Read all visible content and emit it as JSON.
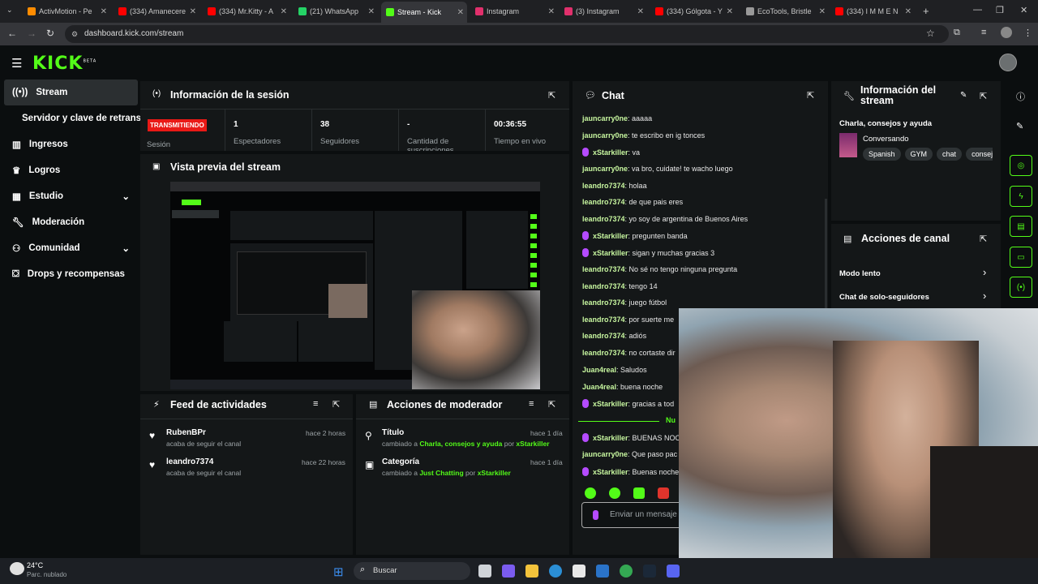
{
  "browser": {
    "tabs": [
      {
        "label": "ActivMotion - Pe",
        "color": "#ff8c00"
      },
      {
        "label": "(334) Amanecere",
        "color": "#ff0000"
      },
      {
        "label": "(334) Mr.Kitty - A",
        "color": "#ff0000"
      },
      {
        "label": "(21) WhatsApp",
        "color": "#25d366"
      },
      {
        "label": "Stream - Kick",
        "color": "#53fc18"
      },
      {
        "label": "Instagram",
        "color": "#e1306c"
      },
      {
        "label": "(3) Instagram",
        "color": "#e1306c"
      },
      {
        "label": "(334) Gólgota - Y",
        "color": "#ff0000"
      },
      {
        "label": "EcoTools, Bristle",
        "color": "#999999"
      },
      {
        "label": "(334) I M M E N",
        "color": "#ff0000"
      }
    ],
    "url": "dashboard.kick.com/stream"
  },
  "brand": {
    "logo": "KICK",
    "beta": "BETA",
    "accent": "#53fc18"
  },
  "sidebar": {
    "items": [
      {
        "label": "Stream",
        "icon": "broadcast-icon"
      },
      {
        "label": "Servidor y clave de retransm",
        "icon": ""
      },
      {
        "label": "Ingresos",
        "icon": "chart-icon"
      },
      {
        "label": "Logros",
        "icon": "trophy-icon"
      },
      {
        "label": "Estudio",
        "icon": "studio-icon"
      },
      {
        "label": "Moderación",
        "icon": "wrench-icon"
      },
      {
        "label": "Comunidad",
        "icon": "community-icon"
      },
      {
        "label": "Drops y recompensas",
        "icon": "gift-icon"
      }
    ]
  },
  "session": {
    "title": "Información de la sesión",
    "status": "TRANSMITIENDO",
    "session_label": "Sesión",
    "stats": [
      {
        "value": "1",
        "label": "Espectadores"
      },
      {
        "value": "38",
        "label": "Seguidores"
      },
      {
        "value": "-",
        "label": "Cantidad de suscripciones"
      },
      {
        "value": "00:36:55",
        "label": "Tiempo en vivo"
      }
    ]
  },
  "preview": {
    "title": "Vista previa del stream"
  },
  "activity": {
    "title": "Feed de actividades",
    "items": [
      {
        "user": "RubenBPr",
        "text": "acaba de seguir el canal",
        "time": "hace 2 horas"
      },
      {
        "user": "leandro7374",
        "text": "acaba de seguir el canal",
        "time": "hace 22 horas"
      }
    ]
  },
  "modactions": {
    "title": "Acciones de moderador",
    "items": [
      {
        "title": "Título",
        "prefix": "cambiado a",
        "value": "Charla, consejos y ayuda",
        "by": "por",
        "user": "xStarkiller",
        "time": "hace 1 día"
      },
      {
        "title": "Categoría",
        "prefix": "cambiado a",
        "value": "Just Chatting",
        "by": "por",
        "user": "xStarkiller",
        "time": "hace 1 día"
      }
    ]
  },
  "chat": {
    "title": "Chat",
    "messages": [
      {
        "user": "jauncarry0ne",
        "text": "aaaaa",
        "mod": false
      },
      {
        "user": "jauncarry0ne",
        "text": "te escribo en ig tonces",
        "mod": false
      },
      {
        "user": "xStarkiller",
        "text": "va",
        "mod": true
      },
      {
        "user": "jauncarry0ne",
        "text": "va bro, cuidate! te wacho luego",
        "mod": false
      },
      {
        "user": "leandro7374",
        "text": "holaa",
        "mod": false
      },
      {
        "user": "leandro7374",
        "text": "de que pais eres",
        "mod": false
      },
      {
        "user": "leandro7374",
        "text": "yo soy de argentina de Buenos Aires",
        "mod": false
      },
      {
        "user": "xStarkiller",
        "text": "pregunten banda",
        "mod": true
      },
      {
        "user": "xStarkiller",
        "text": "sigan y muchas gracias 3",
        "mod": true
      },
      {
        "user": "leandro7374",
        "text": "No sé no tengo ninguna pregunta",
        "mod": false
      },
      {
        "user": "leandro7374",
        "text": "tengo 14",
        "mod": false
      },
      {
        "user": "leandro7374",
        "text": "juego fútbol",
        "mod": false
      },
      {
        "user": "leandro7374",
        "text": "por suerte me",
        "mod": false
      },
      {
        "user": "leandro7374",
        "text": "adiós",
        "mod": false
      },
      {
        "user": "leandro7374",
        "text": "no cortaste dir",
        "mod": false
      },
      {
        "user": "Juan4real",
        "text": "Saludos",
        "mod": false
      },
      {
        "user": "Juan4real",
        "text": "buena noche",
        "mod": false
      },
      {
        "user": "xStarkiller",
        "text": "gracias a tod",
        "mod": true
      }
    ],
    "divider": "Nu",
    "messages2": [
      {
        "user": "xStarkiller",
        "text": "BUENAS NOC",
        "mod": true
      },
      {
        "user": "jauncarry0ne",
        "text": "Que paso pac",
        "mod": false
      },
      {
        "user": "xStarkiller",
        "text": "Buenas noche",
        "mod": true
      }
    ],
    "input_placeholder": "Enviar un mensaje"
  },
  "streaminfo": {
    "title_line1": "Información del",
    "title_line2": "stream",
    "stream_title": "Charla, consejos y ayuda",
    "category": "Conversando",
    "tags": [
      "Spanish",
      "GYM",
      "chat",
      "consejo"
    ]
  },
  "channelactions": {
    "title": "Acciones de canal",
    "items": [
      "Modo lento",
      "Chat de solo-seguidores"
    ]
  },
  "taskbar": {
    "weather_temp": "24°C",
    "weather_desc": "Parc. nublado",
    "search": "Buscar"
  }
}
